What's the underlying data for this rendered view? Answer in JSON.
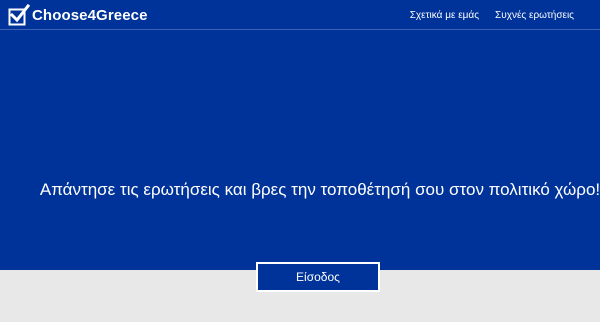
{
  "navbar": {
    "brand": {
      "icon": "checkbox-check-icon",
      "text": "Choose4Greece"
    },
    "links": [
      {
        "label": "Σχετικά με εμάς"
      },
      {
        "label": "Συχνές ερωτήσεις"
      }
    ]
  },
  "hero": {
    "headline": "Απάντησε τις ερωτήσεις και βρες την τοποθέτησή σου στον πολιτικό χώρο!",
    "button_label": "Είσοδος"
  },
  "colors": {
    "primary": "#003399",
    "footer_background": "#e8e8e8",
    "text": "#ffffff"
  }
}
